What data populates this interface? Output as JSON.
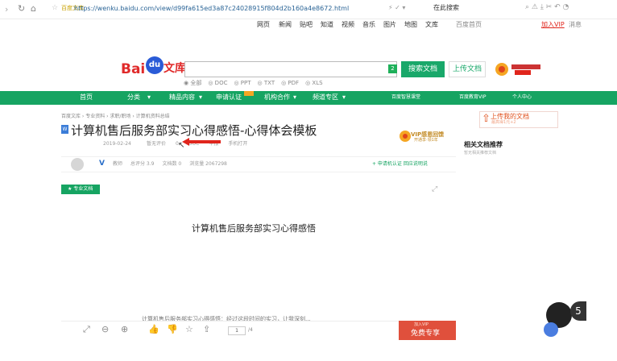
{
  "browser": {
    "url_site": "百度文库",
    "url": "https://wenku.baidu.com/view/d99fa615ed3a87c24028915f804d2b160a4e8672.html",
    "search_hint": "在此搜索"
  },
  "top_links": [
    "网页",
    "新闻",
    "贴吧",
    "知道",
    "视频",
    "音乐",
    "图片",
    "地图",
    "文库",
    "百度首页",
    "加入VIP",
    "消息"
  ],
  "header": {
    "logo_bai": "Bai",
    "logo_du": "du",
    "logo_wenku": "文库",
    "search_badge": "2",
    "search_button": "搜索文档",
    "upload_button": "上传文档",
    "filters": [
      "◉ 全部",
      "◎ DOC",
      "◎ PPT",
      "◎ TXT",
      "◎ PDF",
      "◎ XLS"
    ]
  },
  "nav": [
    "首页",
    "分类",
    "精品内容",
    "申请认证",
    "机构合作",
    "频道专区",
    "百度智慧课堂",
    "百度教育VIP",
    "个人中心"
  ],
  "doc": {
    "breadcrumb": "百度文库 › 专业资料 › 求职/职场 › 计算机资料总结",
    "title": "计算机售后服务部实习心得感悟-心得体会模板",
    "date": "2019-02-24",
    "meta": [
      "暂无评价",
      "0",
      "DOC",
      "举报",
      "手机打开"
    ],
    "vip_title": "VIP感恩回馈",
    "vip_sub": "开通享·领1年"
  },
  "side": {
    "upload_title": "上传我的文档",
    "upload_sub": "最高得1元+2",
    "related_title": "相关文档推荐",
    "related_sub": "暂无相关推荐文档"
  },
  "author": {
    "v_badge": "V",
    "stats": [
      "教师",
      "总评分 3.9",
      "文档数 0",
      "浏览量 2067298"
    ],
    "follow": "+ 申请机认证  回应说明说"
  },
  "content": {
    "pro_label": "专业文档",
    "body_title": "计算机售后服务部实习心得感悟",
    "bottom_line": "计算机售后服务部实习心得感悟：经过这段时间的实习，让我深刻..."
  },
  "toolbar": {
    "page_current": "1",
    "page_total": "/4",
    "vip_top": "加入VIP",
    "vip_main": "免费专享"
  },
  "floating": {
    "number": "5"
  }
}
